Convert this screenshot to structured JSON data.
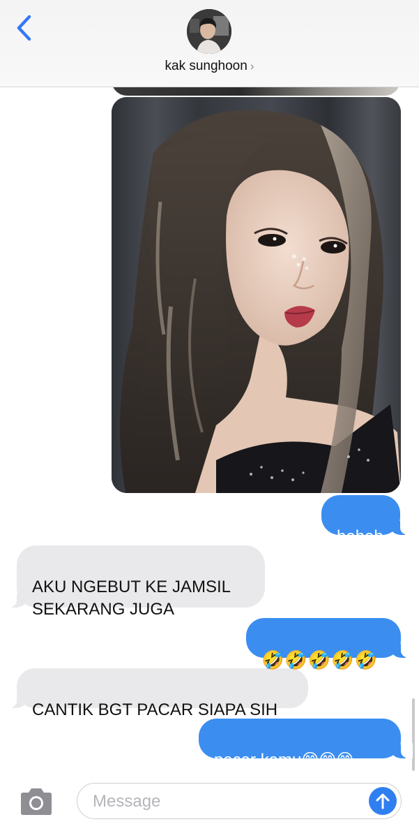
{
  "header": {
    "contact_name": "kak sunghoon",
    "chevron": "›",
    "back_icon": "chevron-left-icon",
    "accent": "#3478f6"
  },
  "messages": [
    {
      "sender": "me",
      "type": "image",
      "description_icon": "photo-attachment"
    },
    {
      "sender": "me",
      "type": "text",
      "text": "heheh"
    },
    {
      "sender": "them",
      "type": "text",
      "text": "AKU NGEBUT KE JAMSIL\nSEKARANG JUGA"
    },
    {
      "sender": "me",
      "type": "text",
      "text": "🤣🤣🤣🤣🤣"
    },
    {
      "sender": "them",
      "type": "text",
      "text": "CANTIK BGT PACAR SIAPA SIH"
    },
    {
      "sender": "me",
      "type": "text",
      "text": "pacar kamu😋😋😋"
    }
  ],
  "composer": {
    "placeholder": "Message",
    "camera_icon": "camera-icon",
    "send_icon": "arrow-up-icon"
  },
  "colors": {
    "outgoing_bubble": "#3b8ef0",
    "incoming_bubble": "#e9e9eb",
    "send_button": "#2f7ff0"
  }
}
